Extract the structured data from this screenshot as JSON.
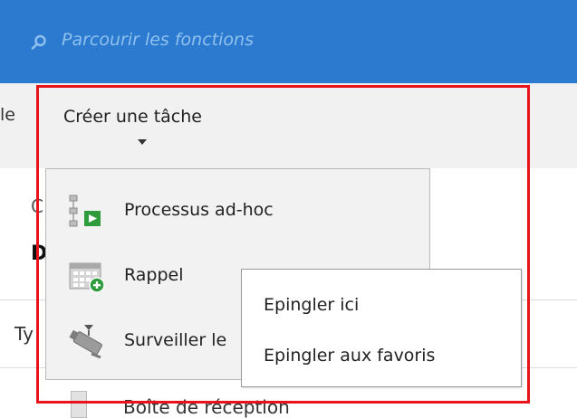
{
  "search": {
    "placeholder": "Parcourir les fonctions"
  },
  "ribbon": {
    "left_partial_label": "le",
    "create_task_label": "Créer une tâche"
  },
  "background": {
    "letter_c": "C",
    "letter_d": "D",
    "letter_ty": "Ty",
    "inbox_label": "Boîte de réception"
  },
  "dropdown": {
    "items": [
      {
        "label": "Processus ad-hoc",
        "icon": "adhoc-process-icon"
      },
      {
        "label": "Rappel",
        "icon": "reminder-icon"
      },
      {
        "label": "Surveiller le",
        "icon": "surveillance-camera-icon"
      }
    ]
  },
  "context_menu": {
    "items": [
      {
        "label": "Epingler ici"
      },
      {
        "label": "Epingler aux favoris"
      }
    ]
  },
  "colors": {
    "topbar": "#2b7ad0",
    "search_text": "#8fc1ee",
    "highlight": "#e8141b",
    "ribbon_bg": "#f1f1f1"
  }
}
